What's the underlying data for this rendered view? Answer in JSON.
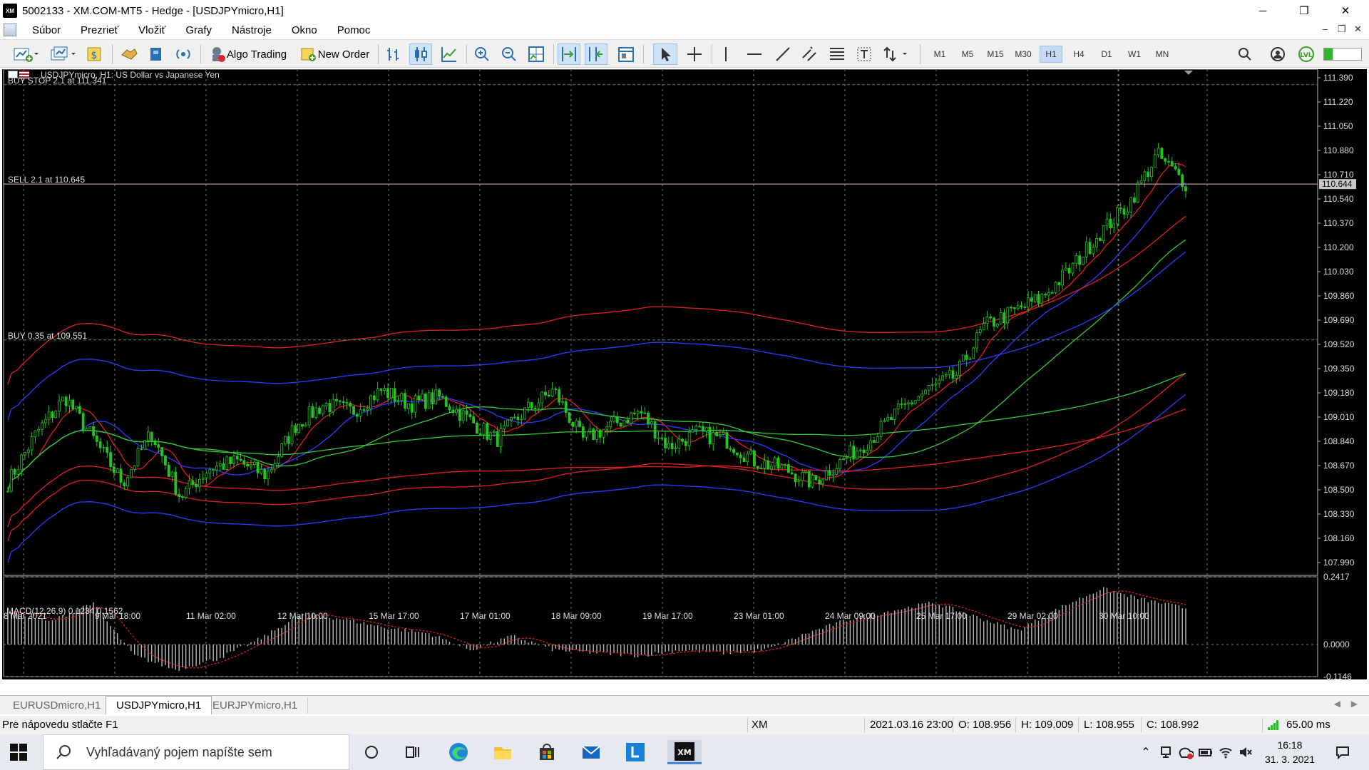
{
  "window": {
    "app_logo": "XM",
    "title": "5002133 - XM.COM-MT5 - Hedge - [USDJPYmicro,H1]",
    "minimize": "─",
    "maximize": "❐",
    "close": "✕"
  },
  "menu": {
    "items": [
      "Súbor",
      "Prezrieť",
      "Vložiť",
      "Grafy",
      "Nástroje",
      "Okno",
      "Pomoc"
    ],
    "mdi_minimize": "–",
    "mdi_restore": "❐",
    "mdi_close": "✕"
  },
  "toolbar": {
    "algo_trading": "Algo Trading",
    "new_order": "New Order",
    "timeframes": [
      "M1",
      "M5",
      "M15",
      "M30",
      "H1",
      "H4",
      "D1",
      "W1",
      "MN"
    ],
    "active_timeframe": "H1"
  },
  "chart": {
    "symbol_label": "USDJPYmicro, H1:  US Dollar vs Japanese Yen",
    "orders": [
      {
        "label": "BUY STOP 2.1 at 111.341",
        "price": 111.341,
        "kind": "pending"
      },
      {
        "label": "SELL 2.1 at 110.645",
        "price": 110.645,
        "kind": "position"
      },
      {
        "label": "BUY 0.35 at 109.551",
        "price": 109.551,
        "kind": "pending"
      }
    ],
    "current_price": "110.644",
    "price_axis_labels": [
      "111.390",
      "111.220",
      "111.050",
      "110.880",
      "110.710",
      "110.540",
      "110.370",
      "110.200",
      "110.030",
      "109.860",
      "109.690",
      "109.520",
      "109.350",
      "109.180",
      "109.010",
      "108.840",
      "108.670",
      "108.500",
      "108.330",
      "108.160",
      "107.990"
    ],
    "time_axis_labels": [
      "8 Mar 2021",
      "9 Mar 18:00",
      "11 Mar 02:00",
      "12 Mar 10:00",
      "15 Mar 17:00",
      "17 Mar 01:00",
      "18 Mar 09:00",
      "19 Mar 17:00",
      "23 Mar 01:00",
      "24 Mar 09:00",
      "25 Mar 17:00",
      "29 Mar 02:00",
      "30 Mar 10:00"
    ],
    "macd_label": "MACD(12,26,9) 0.1234 0.1562",
    "macd_axis_labels": [
      "0.2417",
      "0.0000",
      "-0.1146"
    ]
  },
  "chart_data": {
    "type": "candlestick",
    "symbol": "USDJPYmicro",
    "timeframe": "H1",
    "ylim": [
      107.9,
      111.45
    ],
    "close_anchors": [
      108.55,
      108.9,
      109.15,
      108.85,
      108.55,
      108.9,
      108.45,
      108.65,
      108.7,
      108.6,
      108.95,
      109.1,
      109.05,
      109.2,
      109.1,
      109.15,
      109.0,
      108.85,
      109.05,
      109.2,
      108.85,
      108.95,
      109.05,
      108.8,
      108.9,
      108.85,
      108.7,
      108.65,
      108.55,
      108.7,
      108.85,
      109.05,
      109.2,
      109.3,
      109.65,
      109.75,
      109.85,
      110.05,
      110.3,
      110.5,
      110.85,
      110.65
    ],
    "macd": {
      "macd_anchors": [
        0.12,
        0.08,
        0.15,
        -0.04,
        -0.09,
        -0.05,
        0.02,
        0.11,
        0.09,
        0.06,
        0.04,
        -0.02,
        0.03,
        -0.02,
        -0.03,
        -0.04,
        -0.02,
        -0.03,
        -0.02,
        0.04,
        0.09,
        0.12,
        0.15,
        0.1,
        0.05,
        0.13,
        0.2,
        0.16,
        0.13
      ],
      "ylim": [
        -0.1146,
        0.2417
      ]
    }
  },
  "tabs": [
    "EURUSDmicro,H1",
    "USDJPYmicro,H1",
    "EURJPYmicro,H1"
  ],
  "active_tab": "USDJPYmicro,H1",
  "status": {
    "help": "Pre nápovedu stlačte F1",
    "server": "XM",
    "datetime": "2021.03.16 23:00",
    "open": "O: 108.956",
    "high": "H: 109.009",
    "low": "L: 108.955",
    "close": "C: 108.992",
    "ping": "65.00 ms"
  },
  "taskbar": {
    "search_placeholder": "Vyhľadávaný pojem napíšte sem",
    "time": "16:18",
    "date": "31. 3. 2021"
  }
}
